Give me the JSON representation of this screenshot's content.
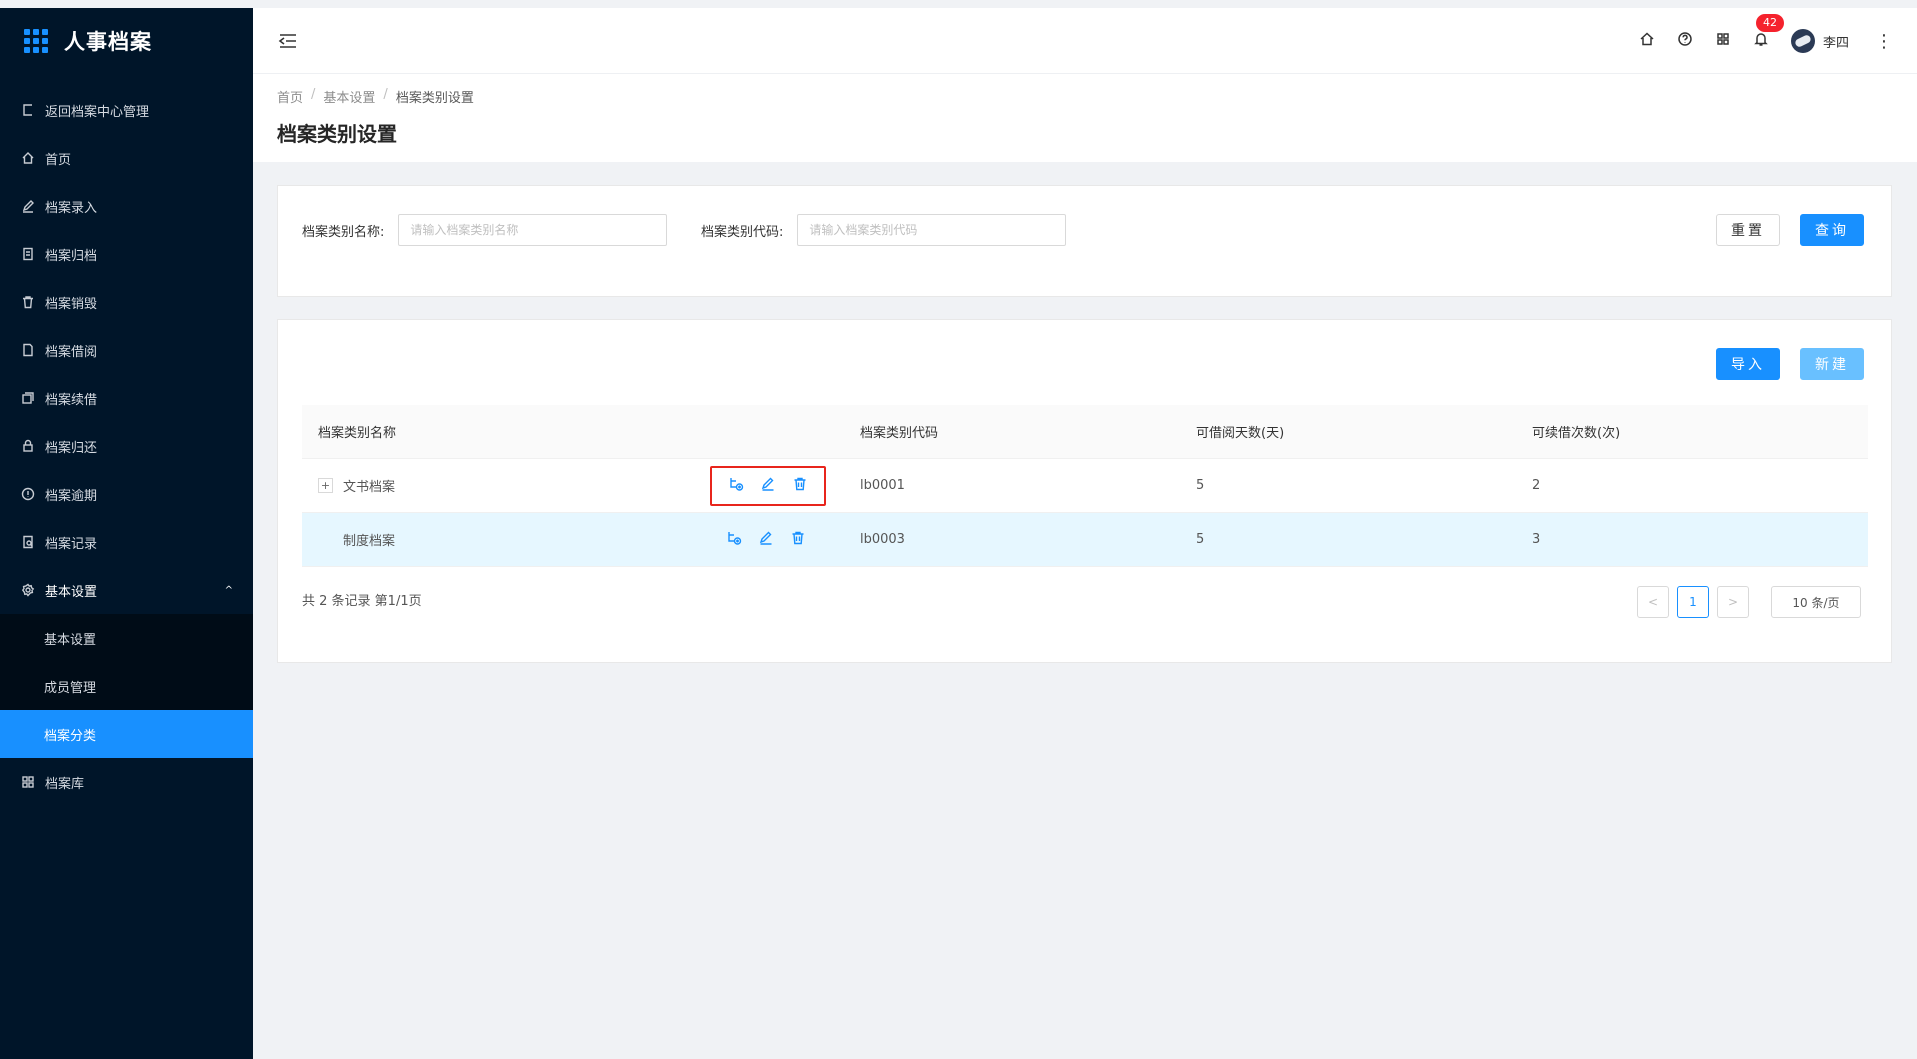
{
  "app": {
    "title": "人事档案"
  },
  "sidebar": {
    "items": [
      {
        "label": "返回档案中心管理",
        "icon": "return-icon"
      },
      {
        "label": "首页",
        "icon": "home-icon"
      },
      {
        "label": "档案录入",
        "icon": "edit-icon"
      },
      {
        "label": "档案归档",
        "icon": "archive-icon"
      },
      {
        "label": "档案销毁",
        "icon": "trash-icon"
      },
      {
        "label": "档案借阅",
        "icon": "file-icon"
      },
      {
        "label": "档案续借",
        "icon": "copy-icon"
      },
      {
        "label": "档案归还",
        "icon": "lock-icon"
      },
      {
        "label": "档案逾期",
        "icon": "alert-icon"
      },
      {
        "label": "档案记录",
        "icon": "record-icon"
      }
    ],
    "settings": {
      "label": "基本设置",
      "icon": "gear-icon",
      "caret": "^"
    },
    "sub_items": [
      {
        "label": "基本设置"
      },
      {
        "label": "成员管理"
      },
      {
        "label": "档案分类",
        "active": true
      }
    ],
    "library": {
      "label": "档案库",
      "icon": "grid-icon"
    }
  },
  "header": {
    "badge_count": "42",
    "user_name": "李四",
    "more": "⋮"
  },
  "breadcrumb": {
    "items": [
      "首页",
      "基本设置",
      "档案类别设置"
    ],
    "sep": "/"
  },
  "page_title": "档案类别设置",
  "search": {
    "name_label": "档案类别名称:",
    "name_placeholder": "请输入档案类别名称",
    "code_label": "档案类别代码:",
    "code_placeholder": "请输入档案类别代码",
    "reset": "重置",
    "query": "查询"
  },
  "toolbar": {
    "import": "导入",
    "create": "新建"
  },
  "table": {
    "columns": [
      "档案类别名称",
      "档案类别代码",
      "可借阅天数(天)",
      "可续借次数(次)"
    ],
    "rows": [
      {
        "expand": "+",
        "name": "文书档案",
        "code": "lb0001",
        "days": "5",
        "renew": "2"
      },
      {
        "name": "制度档案",
        "code": "lb0003",
        "days": "5",
        "renew": "3"
      }
    ]
  },
  "pagination": {
    "total": "共 2 条记录 第1/1页",
    "prev": "<",
    "current": "1",
    "next": ">",
    "size": "10 条/页"
  },
  "colors": {
    "primary": "#1890ff",
    "sidebar": "#001529",
    "highlight_box": "#e8251c"
  }
}
